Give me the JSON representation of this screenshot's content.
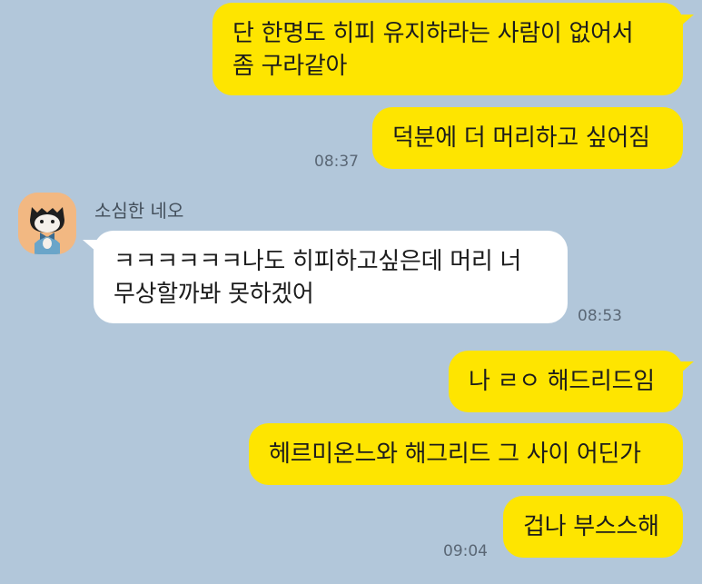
{
  "messages": [
    {
      "side": "mine",
      "text": "단 한명도 히피 유지하라는 사람이 없어서\n좀 구라같아"
    },
    {
      "side": "mine",
      "text": "덕분에 더 머리하고 싶어짐",
      "time": "08:37"
    },
    {
      "side": "theirs",
      "sender": "소심한 네오",
      "text": "ㅋㅋㅋㅋㅋㅋ나도 히피하고싶은데 머리 너\n무상할까봐 못하겠어",
      "time": "08:53"
    },
    {
      "side": "mine",
      "text": "나 ㄹㅇ 해드리드임"
    },
    {
      "side": "mine",
      "text": "헤르미온느와 해그리드 그 사이 어딘가"
    },
    {
      "side": "mine",
      "text": "겁나 부스스해",
      "time": "09:04"
    }
  ],
  "colors": {
    "background": "#b2c7da",
    "my_bubble": "#fee500",
    "their_bubble": "#ffffff",
    "avatar_bg": "#f2b882"
  },
  "icons": {
    "avatar": "neo-cat-avatar-icon"
  }
}
